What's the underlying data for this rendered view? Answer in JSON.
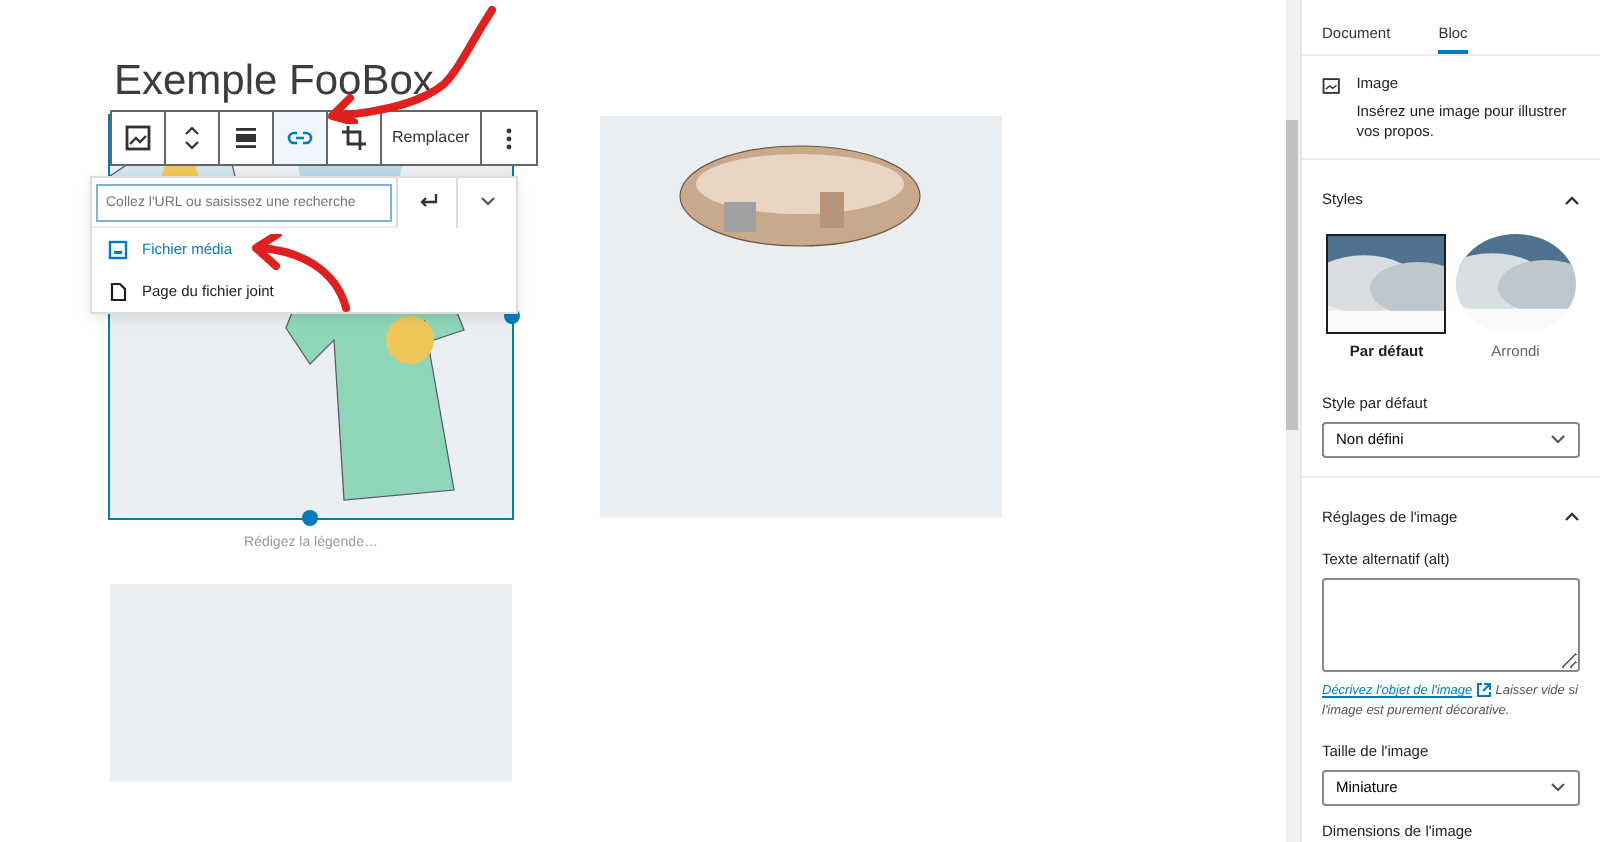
{
  "editor": {
    "title": "Exemple FooBox",
    "toolbar": [
      {
        "kind": "block-type",
        "selected": false
      },
      {
        "kind": "mover",
        "selected": false
      },
      {
        "kind": "align",
        "selected": false
      },
      {
        "kind": "link",
        "selected": true
      },
      {
        "kind": "crop",
        "selected": false
      },
      {
        "kind": "text",
        "label": "Remplacer",
        "selected": false
      },
      {
        "kind": "more",
        "selected": false
      }
    ],
    "link_popover": {
      "placeholder": "Collez l'URL ou saisissez une recherche",
      "options": [
        {
          "kind": "media",
          "label": "Fichier média",
          "selected": true
        },
        {
          "kind": "page",
          "label": "Page du fichier joint",
          "selected": false
        }
      ]
    },
    "gallery": [
      {
        "kind": "picture",
        "selected": true,
        "caption_placeholder": "Rédigez la légende…"
      },
      {
        "kind": "picture",
        "selected": false
      },
      {
        "kind": "picture",
        "selected": false
      }
    ]
  },
  "sidebar": {
    "tabs": [
      {
        "label": "Document",
        "selected": false
      },
      {
        "label": "Bloc",
        "selected": true
      }
    ],
    "block": {
      "name": "Image",
      "description": "Insérez une image pour illustrer vos propos."
    },
    "styles": {
      "title": "Styles",
      "expanded": true,
      "options": [
        {
          "kind": "square",
          "label": "Par défaut",
          "selected": true
        },
        {
          "kind": "rounded",
          "label": "Arrondi",
          "selected": false
        }
      ],
      "default_label": "Style par défaut",
      "default_value": "Non défini"
    },
    "image_settings": {
      "title": "Réglages de l'image",
      "expanded": true,
      "alt_label": "Texte alternatif (alt)",
      "help_link": "Décrivez l'objet de l'image",
      "help_text": "Laisser vide si l'image est purement décorative.",
      "size_label": "Taille de l'image",
      "size_value": "Miniature",
      "next_label": "Dimensions de l'image"
    }
  }
}
